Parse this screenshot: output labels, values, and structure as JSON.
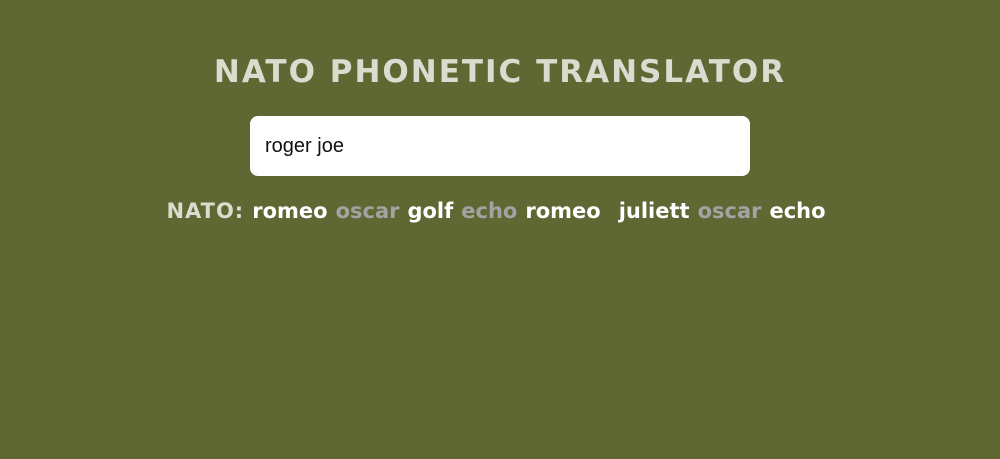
{
  "title": "NATO PHONETIC TRANSLATOR",
  "input": {
    "value": "roger joe",
    "placeholder": ""
  },
  "output": {
    "prefix": "NATO:",
    "words": [
      {
        "text": "romeo",
        "tone": "consonant"
      },
      {
        "text": "oscar",
        "tone": "vowel"
      },
      {
        "text": "golf",
        "tone": "consonant"
      },
      {
        "text": "echo",
        "tone": "vowel"
      },
      {
        "text": "romeo",
        "tone": "consonant"
      },
      {
        "text": "",
        "tone": "space"
      },
      {
        "text": "juliett",
        "tone": "consonant"
      },
      {
        "text": "oscar",
        "tone": "vowel"
      },
      {
        "text": "echo",
        "tone": "consonant"
      }
    ]
  },
  "colors": {
    "background": "#5f6733",
    "title": "#d9dccf",
    "consonant": "#ffffff",
    "vowel": "#a3a3a3"
  }
}
